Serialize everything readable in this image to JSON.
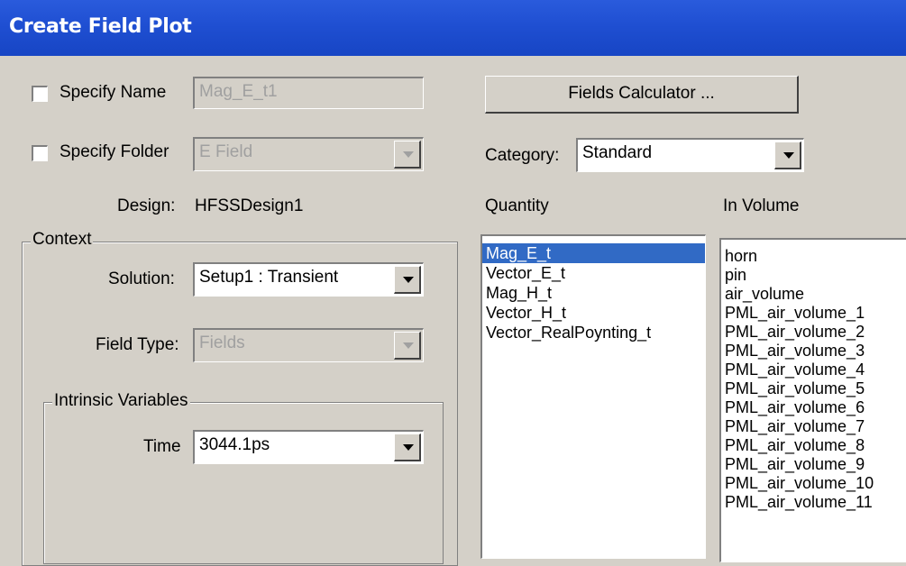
{
  "window": {
    "title": "Create Field Plot"
  },
  "specify_name": {
    "label": "Specify Name",
    "checked": false,
    "value": "Mag_E_t1"
  },
  "specify_folder": {
    "label": "Specify Folder",
    "checked": false,
    "value": "E Field"
  },
  "design": {
    "label": "Design:",
    "value": "HFSSDesign1"
  },
  "context": {
    "label": "Context",
    "solution": {
      "label": "Solution:",
      "value": "Setup1 : Transient"
    },
    "field_type": {
      "label": "Field Type:",
      "value": "Fields"
    },
    "intrinsic": {
      "label": "Intrinsic Variables",
      "time": {
        "label": "Time",
        "value": "3044.1ps"
      }
    }
  },
  "fields_calculator": {
    "label": "Fields Calculator ..."
  },
  "category": {
    "label": "Category:",
    "value": "Standard"
  },
  "quantity": {
    "label": "Quantity",
    "items": [
      "Mag_E_t",
      "Vector_E_t",
      "Mag_H_t",
      "Vector_H_t",
      "Vector_RealPoynting_t"
    ],
    "selected": "Mag_E_t"
  },
  "in_volume": {
    "label": "In Volume",
    "items": [
      "horn",
      "pin",
      "air_volume",
      "PML_air_volume_1",
      "PML_air_volume_2",
      "PML_air_volume_3",
      "PML_air_volume_4",
      "PML_air_volume_5",
      "PML_air_volume_6",
      "PML_air_volume_7",
      "PML_air_volume_8",
      "PML_air_volume_9",
      "PML_air_volume_10",
      "PML_air_volume_11"
    ]
  },
  "colors": {
    "title_bar": "#1f4fd2",
    "dialog_bg": "#d4d0c8",
    "selection": "#316ac5"
  }
}
